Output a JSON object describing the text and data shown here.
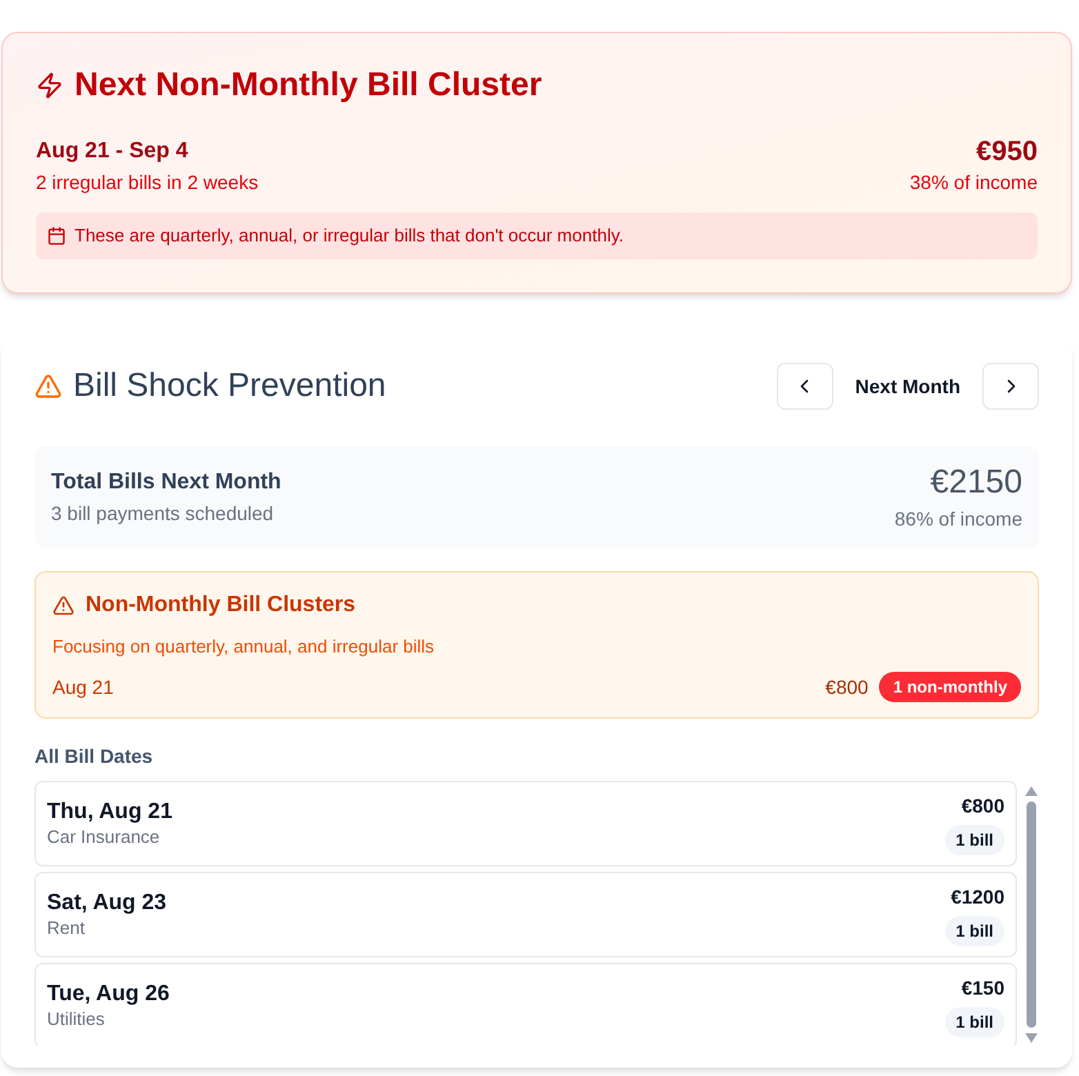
{
  "cluster_card": {
    "title": "Next Non-Monthly Bill Cluster",
    "date_range": "Aug 21 - Sep 4",
    "summary": "2 irregular bills in 2 weeks",
    "amount": "€950",
    "income_share": "38% of income",
    "note": "These are quarterly, annual, or irregular bills that don't occur monthly."
  },
  "bill_shock": {
    "title": "Bill Shock Prevention",
    "period": "Next Month",
    "total": {
      "label": "Total Bills Next Month",
      "detail": "3 bill payments scheduled",
      "amount": "€2150",
      "income_share": "86% of income"
    },
    "clusters": {
      "title": "Non-Monthly Bill Clusters",
      "description": "Focusing on quarterly, annual, and irregular bills",
      "items": [
        {
          "date": "Aug 21",
          "amount": "€800",
          "badge": "1 non-monthly"
        }
      ]
    },
    "list_title": "All Bill Dates",
    "bill_dates": [
      {
        "date": "Thu, Aug 21",
        "name": "Car Insurance",
        "amount": "€800",
        "count": "1 bill"
      },
      {
        "date": "Sat, Aug 23",
        "name": "Rent",
        "amount": "€1200",
        "count": "1 bill"
      },
      {
        "date": "Tue, Aug 26",
        "name": "Utilities",
        "amount": "€150",
        "count": "1 bill"
      }
    ]
  }
}
